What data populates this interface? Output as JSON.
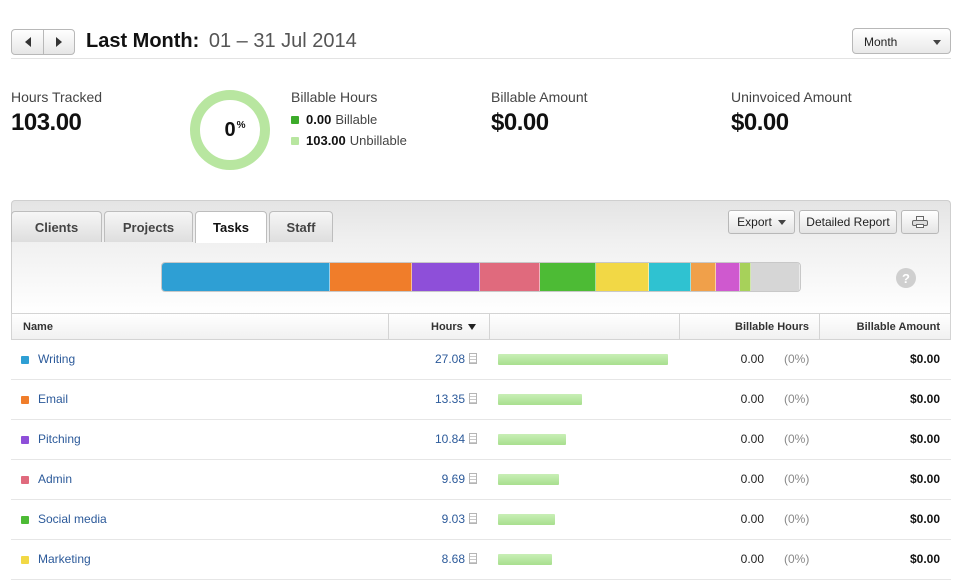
{
  "header": {
    "title_label": "Last Month:",
    "date_range": "01 – 31 Jul 2014",
    "period_select": "Month"
  },
  "summary": {
    "hours_tracked_label": "Hours Tracked",
    "hours_tracked_value": "103.00",
    "donut_value": "0",
    "donut_unit": "%",
    "billable_hours_label": "Billable Hours",
    "billable_value": "0.00",
    "billable_text": "Billable",
    "unbillable_value": "103.00",
    "unbillable_text": "Unbillable",
    "billable_amount_label": "Billable Amount",
    "billable_amount_value": "$0.00",
    "uninvoiced_label": "Uninvoiced Amount",
    "uninvoiced_value": "$0.00"
  },
  "tabs": [
    {
      "label": "Clients"
    },
    {
      "label": "Projects"
    },
    {
      "label": "Tasks"
    },
    {
      "label": "Staff"
    }
  ],
  "toolbar": {
    "export_label": "Export",
    "detailed_report_label": "Detailed Report"
  },
  "table": {
    "headers": {
      "name": "Name",
      "hours": "Hours",
      "billable_hours": "Billable Hours",
      "billable_amount": "Billable Amount"
    },
    "rows": [
      {
        "name": "Writing",
        "hours": "27.08",
        "billable_hours": "0.00",
        "billable_pct": "(0%)",
        "billable_amount": "$0.00",
        "color": "#2e9fd4"
      },
      {
        "name": "Email",
        "hours": "13.35",
        "billable_hours": "0.00",
        "billable_pct": "(0%)",
        "billable_amount": "$0.00",
        "color": "#f07d2a"
      },
      {
        "name": "Pitching",
        "hours": "10.84",
        "billable_hours": "0.00",
        "billable_pct": "(0%)",
        "billable_amount": "$0.00",
        "color": "#8e4fd9"
      },
      {
        "name": "Admin",
        "hours": "9.69",
        "billable_hours": "0.00",
        "billable_pct": "(0%)",
        "billable_amount": "$0.00",
        "color": "#e06a7d"
      },
      {
        "name": "Social media",
        "hours": "9.03",
        "billable_hours": "0.00",
        "billable_pct": "(0%)",
        "billable_amount": "$0.00",
        "color": "#4dbb35"
      },
      {
        "name": "Marketing",
        "hours": "8.68",
        "billable_hours": "0.00",
        "billable_pct": "(0%)",
        "billable_amount": "$0.00",
        "color": "#f2d845"
      }
    ]
  },
  "stacked_bar_segments": [
    {
      "hours": 27.08,
      "color": "#2e9fd4"
    },
    {
      "hours": 13.35,
      "color": "#f07d2a"
    },
    {
      "hours": 10.84,
      "color": "#8e4fd9"
    },
    {
      "hours": 9.69,
      "color": "#e06a7d"
    },
    {
      "hours": 9.03,
      "color": "#4dbb35"
    },
    {
      "hours": 8.68,
      "color": "#f2d845"
    },
    {
      "hours": 6.7,
      "color": "#2fc2d1"
    },
    {
      "hours": 4.0,
      "color": "#f0a04a"
    },
    {
      "hours": 3.9,
      "color": "#cf59cf"
    },
    {
      "hours": 1.8,
      "color": "#a7d15a"
    },
    {
      "hours": 7.93,
      "color": "#d6d6d6"
    }
  ],
  "colors": {
    "billable": "#3cab2a",
    "unbillable": "#b8e6a0",
    "link": "#2c5a9a"
  }
}
